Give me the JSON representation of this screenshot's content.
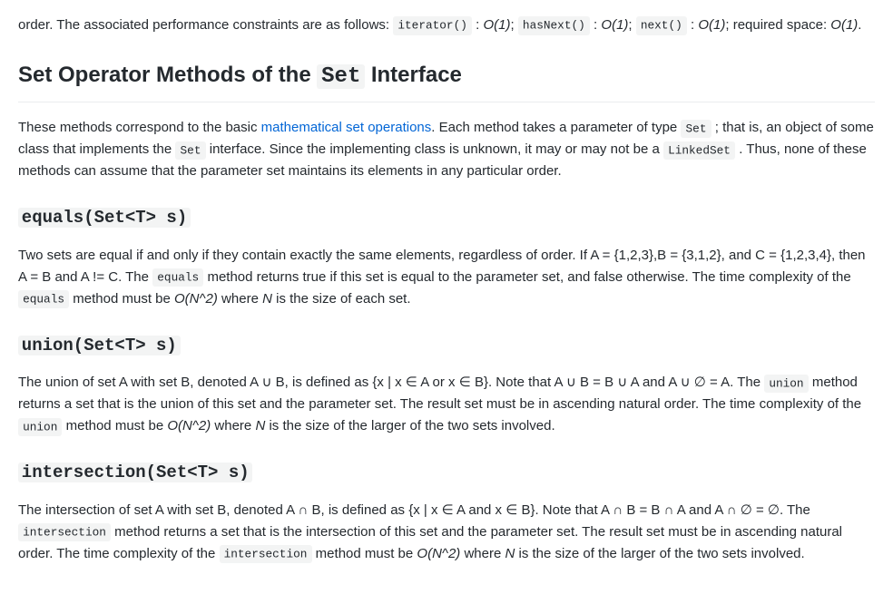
{
  "fragment": {
    "pre": "order. The associated performance constraints are as follows: ",
    "c1": "iterator()",
    "t1": " : ",
    "e1": "O(1)",
    "t2": "; ",
    "c2": "hasNext()",
    "t3": " : ",
    "e2": "O(1)",
    "t4": "; ",
    "c3": "next()",
    "t5": " : ",
    "e3": "O(1)",
    "t6": "; required space: ",
    "e4": "O(1)",
    "t7": "."
  },
  "heading": {
    "pre": "Set Operator Methods of the ",
    "code": "Set",
    "post": " Interface"
  },
  "intro": {
    "t1": "These methods correspond to the basic ",
    "link": "mathematical set operations",
    "t2": ". Each method takes a parameter of type ",
    "c1": "Set",
    "t3": " ; that is, an object of some class that implements the ",
    "c2": "Set",
    "t4": " interface. Since the implementing class is unknown, it may or may not be a ",
    "c3": "LinkedSet",
    "t5": " . Thus, none of these methods can assume that the parameter set maintains its elements in any particular order."
  },
  "equals": {
    "heading": "equals(Set<T> s)",
    "t1": "Two sets are equal if and only if they contain exactly the same elements, regardless of order. If A = {1,2,3},B = {3,1,2}, and C = {1,2,3,4}, then A = B and A != C. The ",
    "c1": "equals",
    "t2": " method returns true if this set is equal to the parameter set, and false otherwise. The time complexity of the ",
    "c2": "equals",
    "t3": " method must be ",
    "e1": "O(N^2)",
    "t4": " where ",
    "e2": "N",
    "t5": " is the size of each set."
  },
  "union": {
    "heading": "union(Set<T> s)",
    "t1": "The union of set A with set B, denoted A ∪ B, is defined as {x | x ∈ A or x ∈ B}. Note that A ∪ B = B ∪ A and A ∪ ∅ = A. The ",
    "c1": "union",
    "t2": " method returns a set that is the union of this set and the parameter set. The result set must be in ascending natural order. The time complexity of the ",
    "c2": "union",
    "t3": " method must be ",
    "e1": "O(N^2)",
    "t4": " where ",
    "e2": "N",
    "t5": " is the size of the larger of the two sets involved."
  },
  "intersection": {
    "heading": "intersection(Set<T> s)",
    "t1": "The intersection of set A with set B, denoted A ∩ B, is defined as {x | x ∈ A and x ∈ B}. Note that A ∩ B = B ∩ A and A ∩ ∅ = ∅. The ",
    "c1": "intersection",
    "t2": " method returns a set that is the intersection of this set and the parameter set. The result set must be in ascending natural order. The time complexity of the ",
    "c2": "intersection",
    "t3": " method must be ",
    "e1": "O(N^2)",
    "t4": " where ",
    "e2": "N",
    "t5": " is the size of the larger of the two sets involved."
  }
}
